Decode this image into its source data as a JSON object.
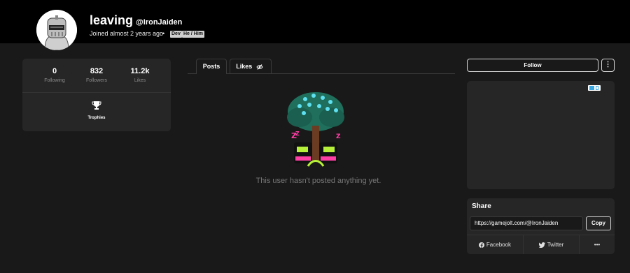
{
  "profile": {
    "display_name": "leaving",
    "handle": "@IronJaiden",
    "joined": "Joined almost 2 years ago",
    "separator": "•",
    "tags": [
      "Dev",
      "He / Him"
    ]
  },
  "stats": [
    {
      "value": "0",
      "label": "Following"
    },
    {
      "value": "832",
      "label": "Followers"
    },
    {
      "value": "11.2k",
      "label": "Likes"
    }
  ],
  "trophies_label": "Trophies",
  "tabs": [
    {
      "label": "Posts"
    },
    {
      "label": "Likes"
    }
  ],
  "empty_message": "This user hasn't posted anything yet.",
  "actions": {
    "follow_label": "Follow",
    "more_label": "⋮"
  },
  "share": {
    "title": "Share",
    "url": "https://gamejolt.com/@IronJaiden",
    "copy_label": "Copy",
    "facebook_label": "Facebook",
    "twitter_label": "Twitter",
    "more_label": "•••"
  },
  "icons": {
    "trophy": "trophy-icon",
    "likes_hidden": "eye-slash-icon",
    "facebook": "facebook-icon",
    "twitter": "twitter-icon"
  },
  "colors": {
    "header_bg": "#000000",
    "page_bg": "#191919",
    "card_bg": "#262626",
    "muted_text": "#8a8a8a"
  }
}
